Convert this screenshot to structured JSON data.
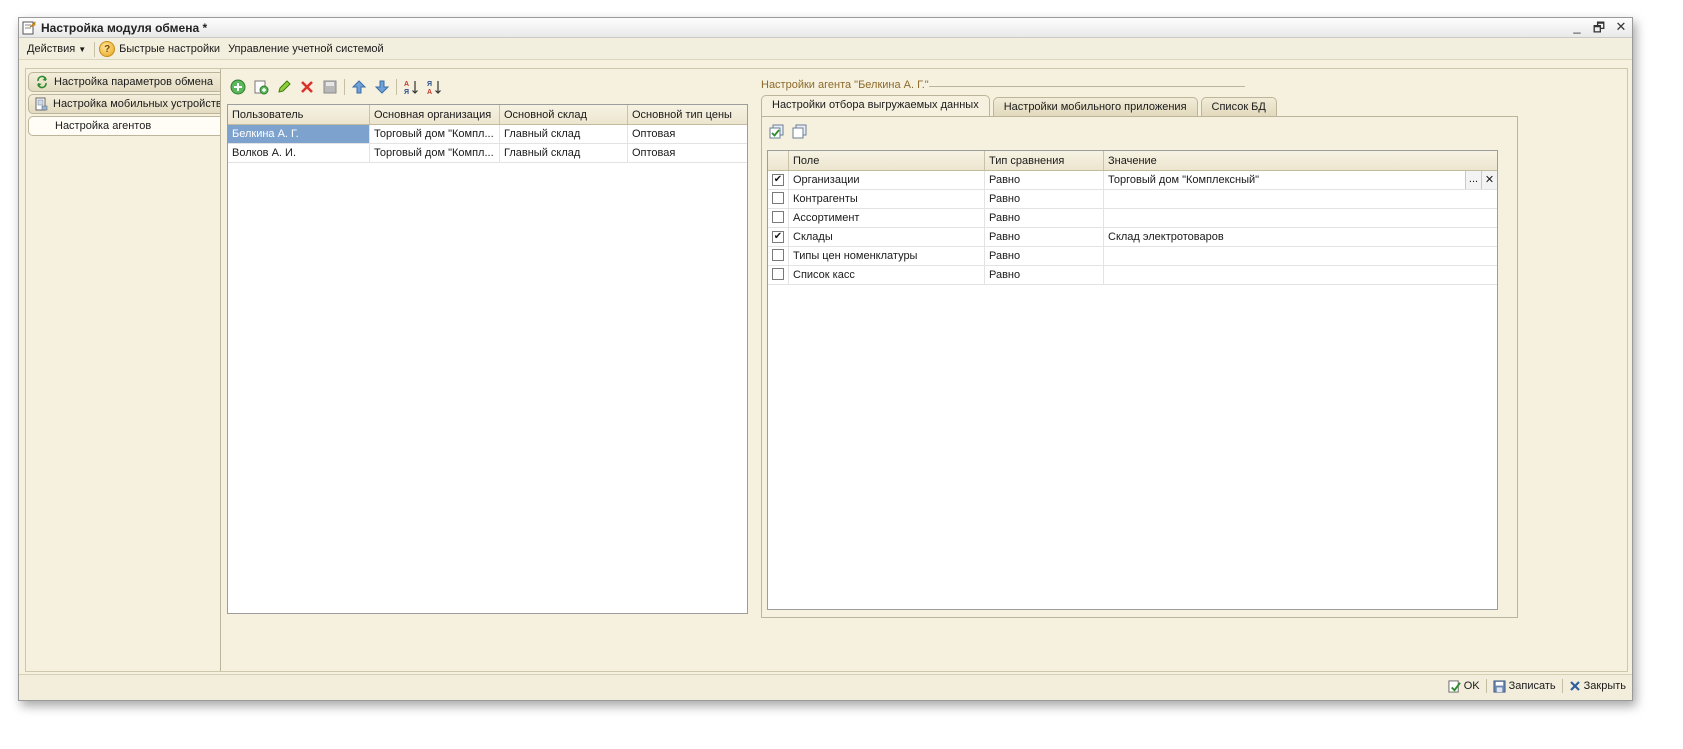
{
  "window": {
    "title": "Настройка модуля обмена *",
    "controls": [
      "_",
      "🗗",
      "✕"
    ]
  },
  "menu": {
    "actions": "Действия",
    "help_icon": "?",
    "quick_settings": "Быстрые настройки",
    "account_management": "Управление учетной системой"
  },
  "sidebar": {
    "items": [
      {
        "label": "Настройка параметров обмена",
        "icon": "refresh-icon"
      },
      {
        "label": "Настройка мобильных устройств",
        "icon": "device-icon"
      },
      {
        "label": "Настройка агентов",
        "icon": ""
      }
    ],
    "active_index": 2
  },
  "agents_table": {
    "columns": [
      "Пользователь",
      "Основная организация",
      "Основной склад",
      "Основной тип цены"
    ],
    "rows": [
      [
        "Белкина А. Г.",
        "Торговый дом \"Компл...",
        "Главный склад",
        "Оптовая"
      ],
      [
        "Волков А. И.",
        "Торговый дом \"Компл...",
        "Главный склад",
        "Оптовая"
      ]
    ],
    "selected_row": 0
  },
  "agent_settings": {
    "group_title": "Настройки агента \"Белкина А. Г.\"",
    "tabs": [
      "Настройки отбора выгружаемых данных",
      "Настройки мобильного приложения",
      "Список БД"
    ],
    "active_tab": 0,
    "filter_table": {
      "columns": [
        "Поле",
        "Тип сравнения",
        "Значение"
      ],
      "rows": [
        {
          "checked": true,
          "field": "Организации",
          "comparison": "Равно",
          "value": "Торговый дом \"Комплексный\""
        },
        {
          "checked": false,
          "field": "Контрагенты",
          "comparison": "Равно",
          "value": ""
        },
        {
          "checked": false,
          "field": "Ассортимент",
          "comparison": "Равно",
          "value": ""
        },
        {
          "checked": true,
          "field": "Склады",
          "comparison": "Равно",
          "value": "Склад электротоваров"
        },
        {
          "checked": false,
          "field": "Типы цен номенклатуры",
          "comparison": "Равно",
          "value": ""
        },
        {
          "checked": false,
          "field": "Список касс",
          "comparison": "Равно",
          "value": ""
        }
      ],
      "value_buttons": [
        "...",
        "✕"
      ]
    }
  },
  "footer": {
    "ok": "OK",
    "save": "Записать",
    "close": "Закрыть"
  },
  "colors": {
    "background": "#f6f1df",
    "selection": "#7da2ce",
    "group_title": "#8c6a2b"
  }
}
